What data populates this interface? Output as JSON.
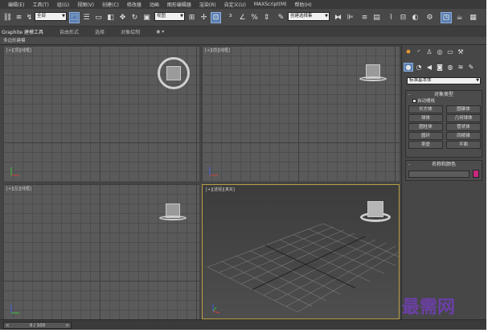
{
  "menu": [
    "编辑(E)",
    "工具(T)",
    "组(G)",
    "视图(V)",
    "创建(C)",
    "修改器",
    "动画",
    "图形编辑器",
    "渲染(R)",
    "自定义(U)",
    "MAXScript(M)",
    "帮助(H)"
  ],
  "toolbar": {
    "selection_filter": "全部",
    "ref_coord": "视图",
    "named_selection": "创建选择集"
  },
  "ribbon": {
    "tabs": [
      "Graphite 建模工具",
      "自由形式",
      "选择",
      "对象绘制"
    ],
    "sub_label": "多边形建模"
  },
  "viewports": {
    "top": "[+][顶][线框]",
    "front": "[+][前][线框]",
    "left": "[+][左][线框]",
    "perspective": "[+][透视][真实]"
  },
  "command_panel": {
    "category": "标准基本体",
    "object_type": {
      "title": "对象类型",
      "autogrid": "自动栅格",
      "buttons": [
        "长方体",
        "圆锥体",
        "球体",
        "几何球体",
        "圆柱体",
        "管状体",
        "圆环",
        "四棱锥",
        "茶壶",
        "平面"
      ]
    },
    "name_color": {
      "title": "名称和颜色"
    },
    "swatch_color": "#c8287f"
  },
  "timeline": {
    "current": "0 / 100"
  },
  "watermark": "最需网"
}
